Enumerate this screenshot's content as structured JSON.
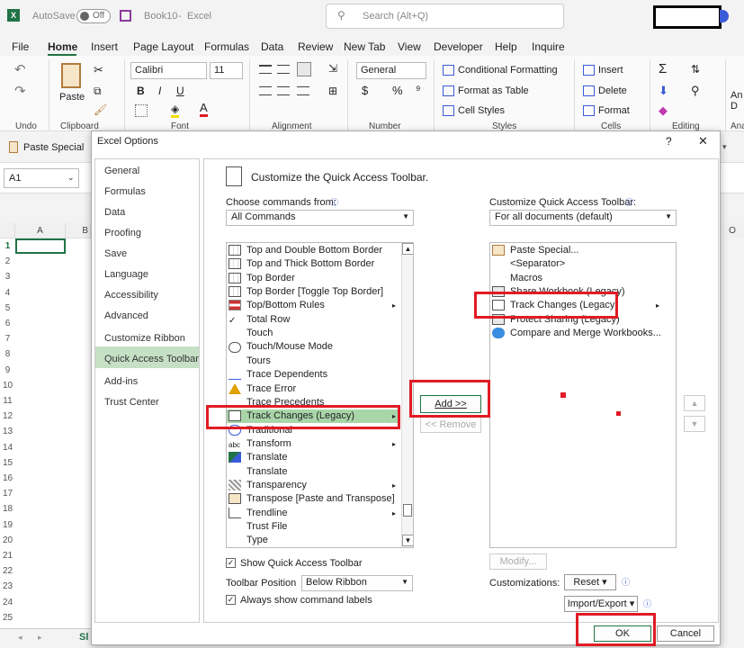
{
  "titlebar": {
    "autosave_label": "AutoSave",
    "autosave_state": "Off",
    "book_title": "Book10",
    "separator": "-",
    "app_name": "Excel",
    "search_placeholder": "Search (Alt+Q)"
  },
  "ribbon_tabs": [
    "File",
    "Home",
    "Insert",
    "Page Layout",
    "Formulas",
    "Data",
    "Review",
    "New Tab",
    "View",
    "Developer",
    "Help",
    "Inquire"
  ],
  "ribbon": {
    "paste": "Paste",
    "font_name": "Calibri",
    "font_size": "11",
    "number_format": "General",
    "conditional_formatting": "Conditional Formatting",
    "format_as_table": "Format as Table",
    "cell_styles": "Cell Styles",
    "insert": "Insert",
    "delete": "Delete",
    "format": "Format",
    "groups": {
      "undo": "Undo",
      "clipboard": "Clipboard",
      "font": "Font",
      "alignment": "Alignment",
      "number": "Number",
      "styles": "Styles",
      "cells": "Cells",
      "editing": "Editing",
      "ana": "Ana"
    },
    "bold": "B",
    "italic": "I",
    "underline": "U",
    "currency": "$",
    "percent": "%",
    "sum": "Σ",
    "right_partial": "An D"
  },
  "qat": {
    "paste_special": "Paste Special"
  },
  "namebox": "A1",
  "sheet": {
    "col_a": "A",
    "col_b": "B",
    "col_o": "O",
    "rows": [
      "1",
      "2",
      "3",
      "4",
      "5",
      "6",
      "7",
      "8",
      "9",
      "10",
      "11",
      "12",
      "13",
      "14",
      "15",
      "16",
      "17",
      "18",
      "19",
      "20",
      "21",
      "22",
      "23",
      "24",
      "25"
    ],
    "tab_partial": "Sl"
  },
  "dialog": {
    "title": "Excel Options",
    "help": "?",
    "close": "✕",
    "nav": [
      "General",
      "Formulas",
      "Data",
      "Proofing",
      "Save",
      "Language",
      "Accessibility",
      "Advanced",
      "Customize Ribbon",
      "Quick Access Toolbar",
      "Add-ins",
      "Trust Center"
    ],
    "nav_selected": "Quick Access Toolbar",
    "heading": "Customize the Quick Access Toolbar.",
    "choose_label": "Choose commands from:",
    "choose_value": "All Commands",
    "customize_label": "Customize Quick Access Toolbar:",
    "customize_value": "For all documents (default)",
    "commands": [
      {
        "label": "Top and Double Bottom Border",
        "icon": "border-icon",
        "arrow": false
      },
      {
        "label": "Top and Thick Bottom Border",
        "icon": "border-icon",
        "arrow": false
      },
      {
        "label": "Top Border",
        "icon": "border-icon",
        "arrow": false
      },
      {
        "label": "Top Border [Toggle Top Border]",
        "icon": "border-icon",
        "arrow": false
      },
      {
        "label": "Top/Bottom Rules",
        "icon": "rules-icon",
        "arrow": true
      },
      {
        "label": "Total Row",
        "icon": "check-icon",
        "arrow": false
      },
      {
        "label": "Touch",
        "icon": "none",
        "arrow": false
      },
      {
        "label": "Touch/Mouse Mode",
        "icon": "touch-icon",
        "arrow": false
      },
      {
        "label": "Tours",
        "icon": "none",
        "arrow": false
      },
      {
        "label": "Trace Dependents",
        "icon": "trace-icon",
        "arrow": false
      },
      {
        "label": "Trace Error",
        "icon": "warning-icon",
        "arrow": false
      },
      {
        "label": "Trace Precedents",
        "icon": "trace-icon",
        "arrow": false
      },
      {
        "label": "Track Changes (Legacy)",
        "icon": "track-changes-icon",
        "arrow": true
      },
      {
        "label": "Traditional",
        "icon": "traditional-icon",
        "arrow": false
      },
      {
        "label": "Transform",
        "icon": "abc-icon",
        "arrow": true
      },
      {
        "label": "Translate",
        "icon": "translate-icon",
        "arrow": false
      },
      {
        "label": "Translate",
        "icon": "none",
        "arrow": false
      },
      {
        "label": "Transparency",
        "icon": "transparency-icon",
        "arrow": true
      },
      {
        "label": "Transpose [Paste and Transpose]",
        "icon": "transpose-icon",
        "arrow": false
      },
      {
        "label": "Trendline",
        "icon": "trendline-icon",
        "arrow": true
      },
      {
        "label": "Trust File",
        "icon": "none",
        "arrow": false
      },
      {
        "label": "Type",
        "icon": "none",
        "arrow": false
      }
    ],
    "selected_command": "Track Changes (Legacy)",
    "qat_items": [
      {
        "label": "Paste Special...",
        "icon": "paste-icon",
        "arrow": false
      },
      {
        "label": "<Separator>",
        "icon": "none",
        "arrow": false
      },
      {
        "label": "Macros",
        "icon": "none",
        "arrow": false
      },
      {
        "label": "Share Workbook (Legacy)",
        "icon": "share-icon",
        "arrow": false
      },
      {
        "label": "Track Changes (Legacy)",
        "icon": "track-changes-icon",
        "arrow": true
      },
      {
        "label": "Protect Sharing (Legacy)",
        "icon": "protect-icon",
        "arrow": false
      },
      {
        "label": "Compare and Merge Workbooks...",
        "icon": "compare-icon",
        "arrow": false
      }
    ],
    "add_button": "Add >>",
    "remove_button": "<< Remove",
    "modify_button": "Modify...",
    "show_qat_label": "Show Quick Access Toolbar",
    "toolbar_position_label": "Toolbar Position",
    "toolbar_position_value": "Below Ribbon",
    "always_show_labels": "Always show command labels",
    "customizations_label": "Customizations:",
    "reset_button": "Reset",
    "import_export_button": "Import/Export",
    "ok_button": "OK",
    "cancel_button": "Cancel"
  },
  "colors": {
    "excel_green": "#217346",
    "selected_nav": "#c6e0c6",
    "selected_item": "#a9d6a9",
    "annotation_red": "#e01b24"
  }
}
